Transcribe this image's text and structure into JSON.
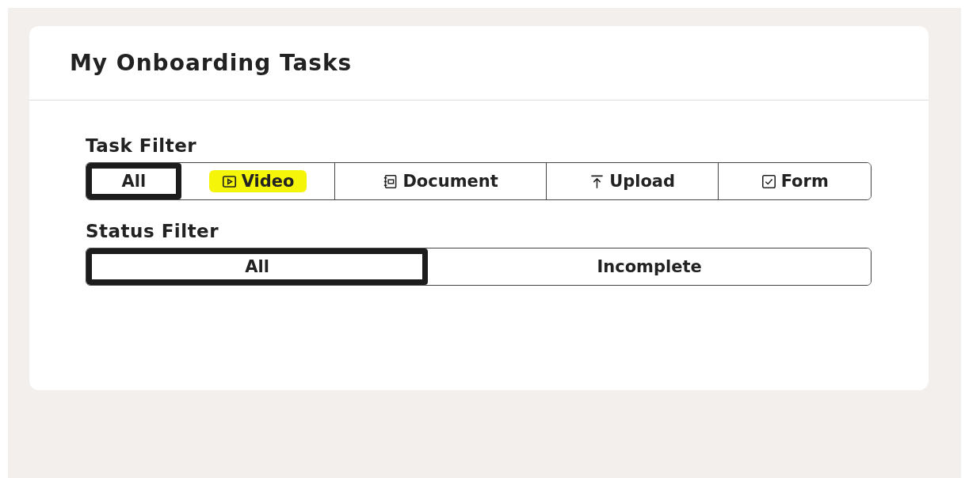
{
  "card": {
    "title": "My Onboarding Tasks"
  },
  "task_filter": {
    "label": "Task Filter",
    "options": [
      {
        "label": "All",
        "kind": "none",
        "selected": true,
        "highlighted": false
      },
      {
        "label": "Video",
        "kind": "video",
        "selected": false,
        "highlighted": true
      },
      {
        "label": "Document",
        "kind": "document",
        "selected": false,
        "highlighted": false
      },
      {
        "label": "Upload",
        "kind": "upload",
        "selected": false,
        "highlighted": false
      },
      {
        "label": "Form",
        "kind": "form",
        "selected": false,
        "highlighted": false
      }
    ]
  },
  "status_filter": {
    "label": "Status Filter",
    "options": [
      {
        "label": "All",
        "selected": true
      },
      {
        "label": "Incomplete",
        "selected": false
      }
    ]
  }
}
